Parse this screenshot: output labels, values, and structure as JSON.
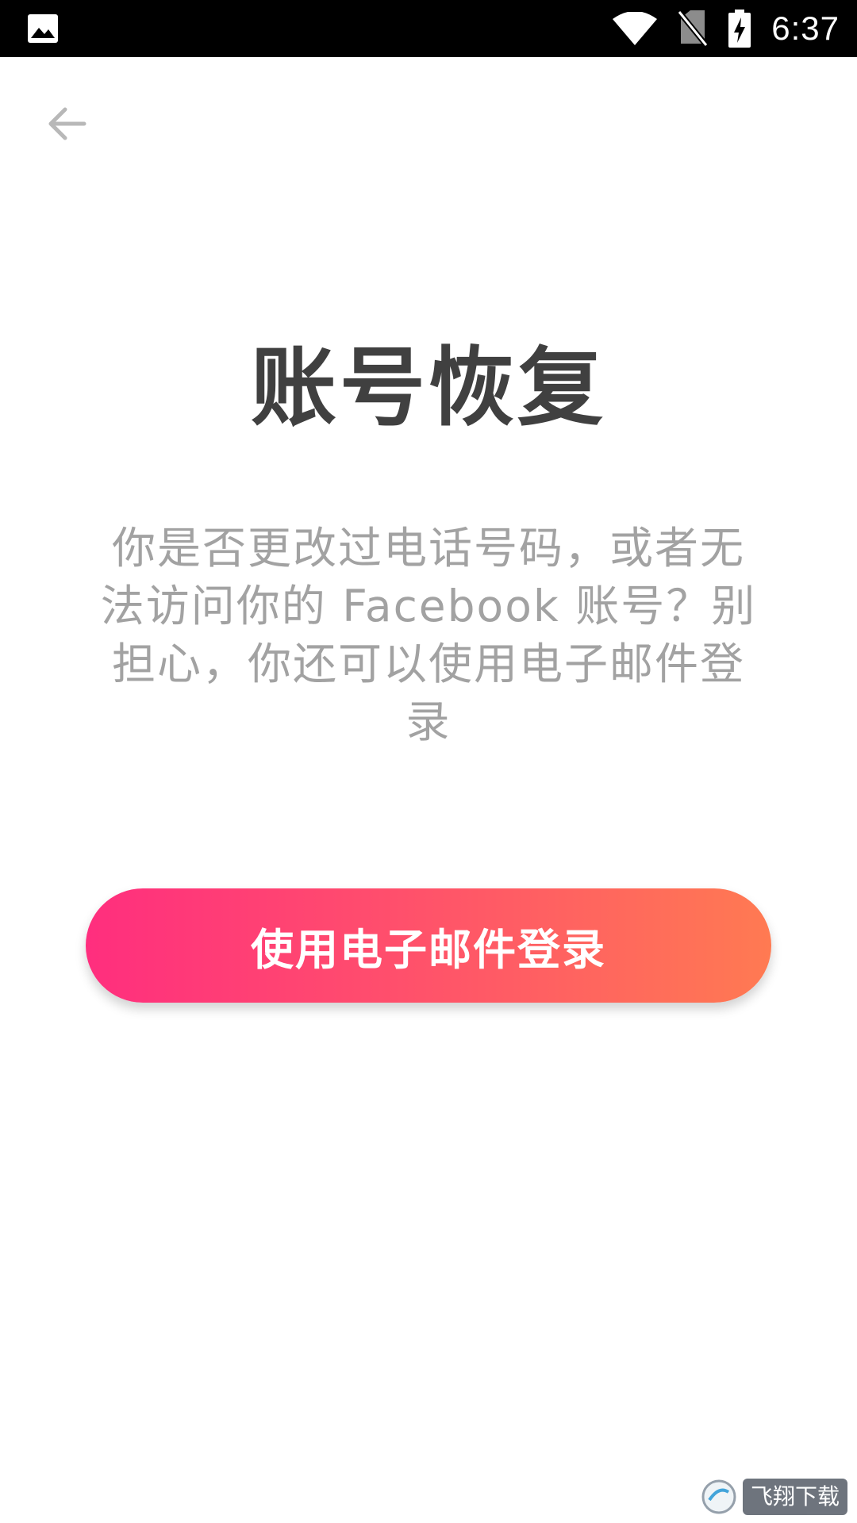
{
  "status_bar": {
    "time": "6:37",
    "left_icon": "image-notification-icon",
    "icons": [
      "wifi-icon",
      "no-sim-icon",
      "battery-charging-icon"
    ]
  },
  "header": {
    "back_icon": "arrow-left-icon"
  },
  "main": {
    "title": "账号恢复",
    "description": "你是否更改过电话号码，或者无法访问你的 Facebook 账号？别担心，你还可以使用电子邮件登录",
    "email_login_button": "使用电子邮件登录"
  },
  "watermark": {
    "text": "飞翔下载"
  },
  "colors": {
    "title": "#404040",
    "description": "#a2a2a2",
    "button_gradient_start": "#ff2e7e",
    "button_gradient_end": "#ff7a52",
    "status_bar_bg": "#000000"
  }
}
